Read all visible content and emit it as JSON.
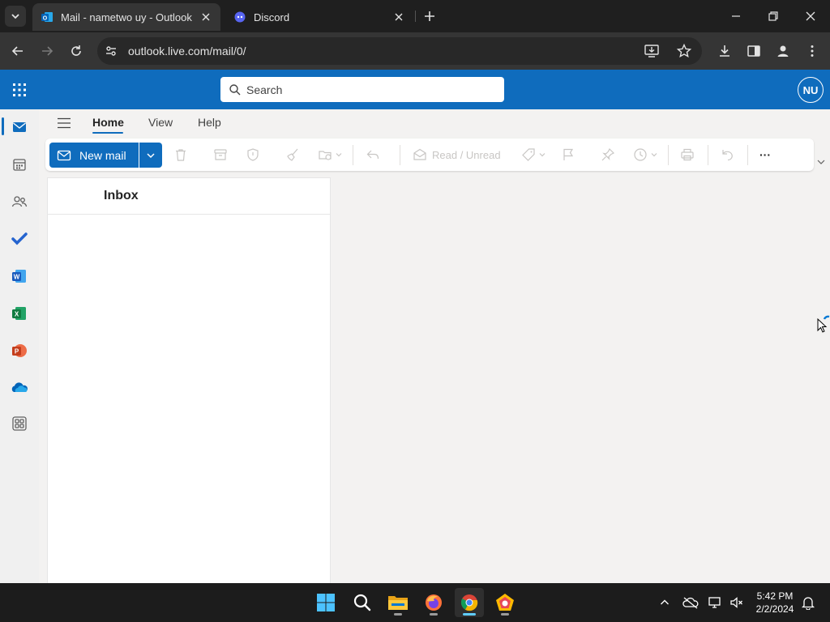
{
  "browser": {
    "tabs": [
      {
        "title": "Mail - nametwo uy - Outlook",
        "active": true
      },
      {
        "title": "Discord",
        "active": false
      }
    ],
    "url": "outlook.live.com/mail/0/"
  },
  "header": {
    "search_placeholder": "Search",
    "avatar_initials": "NU"
  },
  "ribbon": {
    "tabs": [
      "Home",
      "View",
      "Help"
    ],
    "new_mail_label": "New mail",
    "read_unread_label": "Read / Unread",
    "more_label": "···"
  },
  "message_list": {
    "folder_title": "Inbox"
  },
  "taskbar": {
    "time": "5:42 PM",
    "date": "2/2/2024"
  },
  "colors": {
    "brand": "#0f6cbd",
    "chrome_dark": "#1f1f1f",
    "toolbar": "#353535"
  }
}
